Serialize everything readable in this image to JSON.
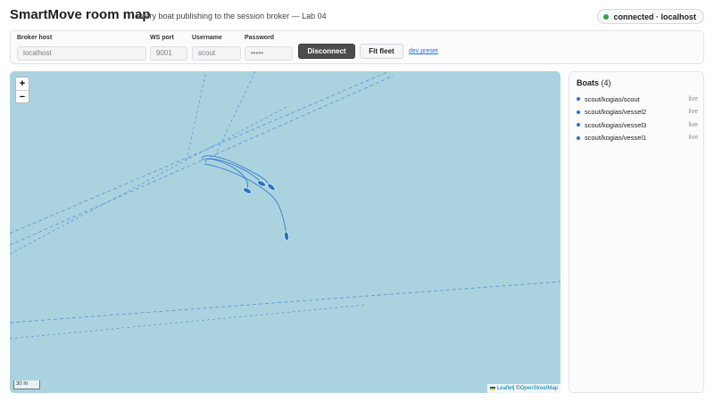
{
  "header": {
    "title": "SmartMove room map",
    "subtitle": "every boat publishing to the session broker — Lab 04",
    "status": "connected · localhost",
    "status_color": "#2ea44f"
  },
  "connection": {
    "broker_host_label": "Broker host",
    "broker_host_value": "localhost",
    "ws_port_label": "WS port",
    "ws_port_value": "9001",
    "username_label": "Username",
    "username_value": "scout",
    "password_label": "Password",
    "password_value": "•••••",
    "disconnect_label": "Disconnect",
    "fit_fleet_label": "Fit fleet",
    "dev_preset_label": "dev preset"
  },
  "map": {
    "zoom_in": "+",
    "zoom_out": "−",
    "scale_label": "30 m",
    "attribution_leaflet": "Leaflet",
    "attribution_sep": " | © ",
    "attribution_osm": "OpenStreetMap",
    "water_color": "#aad3df",
    "boat_color": "#2a73c9"
  },
  "boats_panel": {
    "title": "Boats",
    "count": "(4)",
    "boats": [
      {
        "name": "scout/kogias/scout",
        "status": "live"
      },
      {
        "name": "scout/kogias/vessel2",
        "status": "live"
      },
      {
        "name": "scout/kogias/vessel3",
        "status": "live"
      },
      {
        "name": "scout/kogias/vessel1",
        "status": "live"
      }
    ]
  }
}
